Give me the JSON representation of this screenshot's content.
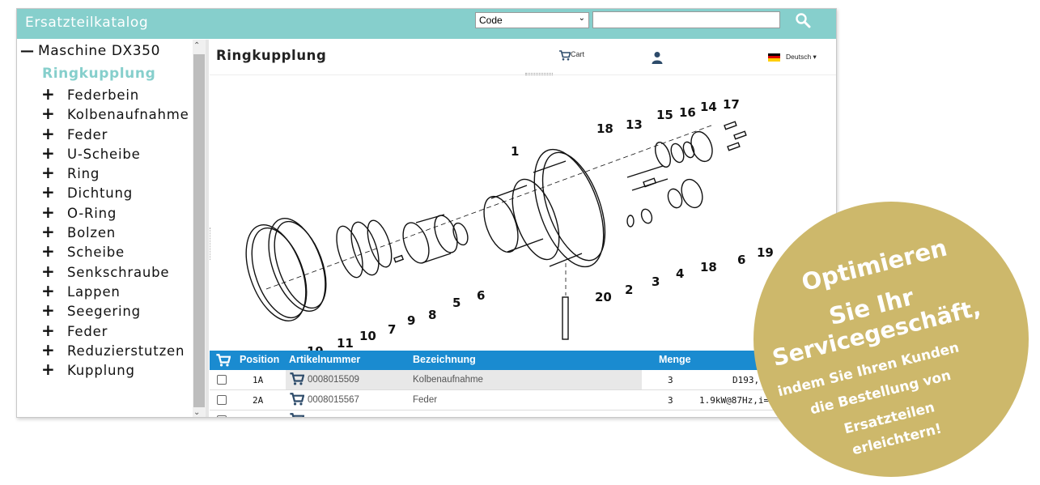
{
  "app": {
    "title": "Ersatzteilkatalog"
  },
  "search": {
    "select_value": "Code",
    "input_value": "",
    "icon": "search-icon"
  },
  "tree": {
    "root_label": "Maschine DX350",
    "active_label": "Ringkupplung",
    "items": [
      {
        "label": "Federbein"
      },
      {
        "label": "Kolbenaufnahme"
      },
      {
        "label": "Feder"
      },
      {
        "label": "U-Scheibe"
      },
      {
        "label": "Ring"
      },
      {
        "label": "Dichtung"
      },
      {
        "label": "O-Ring"
      },
      {
        "label": "Bolzen"
      },
      {
        "label": "Scheibe"
      },
      {
        "label": "Senkschraube"
      },
      {
        "label": "Lappen"
      },
      {
        "label": "Seegering"
      },
      {
        "label": "Feder"
      },
      {
        "label": "Reduzierstutzen"
      },
      {
        "label": "Kupplung"
      }
    ]
  },
  "header": {
    "title": "Ringkupplung",
    "cart_label": "Cart",
    "language_label": "Deutsch",
    "flag_colors": [
      "#000000",
      "#dd0000",
      "#ffce00"
    ]
  },
  "drawing": {
    "callouts": [
      "1",
      "2",
      "3",
      "4",
      "5",
      "6",
      "6",
      "7",
      "8",
      "9",
      "10",
      "11",
      "13",
      "14",
      "15",
      "16",
      "17",
      "18",
      "18",
      "19",
      "20",
      "19"
    ]
  },
  "table": {
    "columns": {
      "position": "Position",
      "artikelnummer": "Artikelnummer",
      "bezeichnung": "Bezeichnung",
      "menge": "Menge"
    },
    "rows": [
      {
        "position": "1A",
        "artikelnummer": "0008015509",
        "bezeichnung": "Kolbenaufnahme",
        "menge": "3",
        "extra": "D193, 4"
      },
      {
        "position": "2A",
        "artikelnummer": "0008015567",
        "bezeichnung": "Feder",
        "menge": "3",
        "extra": "1.9kW@87Hz,i=5"
      }
    ]
  },
  "promo": {
    "lines": [
      "Optimieren",
      "Sie Ihr",
      "Servicegeschäft,",
      "indem Sie Ihren Kunden",
      "die Bestellung von",
      "Ersatzteilen",
      "erleichtern!"
    ]
  },
  "colors": {
    "accent": "#86cfcc",
    "table_header": "#1a8bd0",
    "badge": "#cdb86b"
  }
}
